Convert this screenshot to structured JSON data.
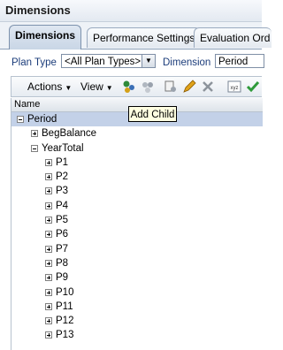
{
  "window": {
    "title": "Dimensions"
  },
  "tabs": [
    {
      "label": "Dimensions",
      "active": true
    },
    {
      "label": "Performance Settings",
      "active": false
    },
    {
      "label": "Evaluation Ord",
      "active": false
    }
  ],
  "filters": {
    "plan_type_label": "Plan Type",
    "plan_type_value": "<All Plan Types>",
    "dimension_label": "Dimension",
    "dimension_value": "Period"
  },
  "toolbar": {
    "actions_label": "Actions",
    "view_label": "View",
    "icons": [
      "add-child-icon",
      "add-sibling-icon",
      "edit-properties-icon",
      "pencil-icon",
      "delete-icon",
      "xyz-icon",
      "checkmark-icon"
    ]
  },
  "tooltip": {
    "text": "Add Child"
  },
  "grid": {
    "column_header": "Name",
    "rows": [
      {
        "label": "Period",
        "expander": "minus",
        "selected": true
      },
      {
        "label": "BegBalance",
        "expander": "plus",
        "selected": false
      },
      {
        "label": "YearTotal",
        "expander": "minus",
        "selected": false
      },
      {
        "label": "P1",
        "expander": "plus",
        "selected": false
      },
      {
        "label": "P2",
        "expander": "plus",
        "selected": false
      },
      {
        "label": "P3",
        "expander": "plus",
        "selected": false
      },
      {
        "label": "P4",
        "expander": "plus",
        "selected": false
      },
      {
        "label": "P5",
        "expander": "plus",
        "selected": false
      },
      {
        "label": "P6",
        "expander": "plus",
        "selected": false
      },
      {
        "label": "P7",
        "expander": "plus",
        "selected": false
      },
      {
        "label": "P8",
        "expander": "plus",
        "selected": false
      },
      {
        "label": "P9",
        "expander": "plus",
        "selected": false
      },
      {
        "label": "P10",
        "expander": "plus",
        "selected": false
      },
      {
        "label": "P11",
        "expander": "plus",
        "selected": false
      },
      {
        "label": "P12",
        "expander": "plus",
        "selected": false
      },
      {
        "label": "P13",
        "expander": "plus",
        "selected": false
      }
    ]
  },
  "colors": {
    "selected_row": "#c3d1e8",
    "label_blue": "#1b3c7a",
    "tooltip_bg": "#ffffe1"
  }
}
